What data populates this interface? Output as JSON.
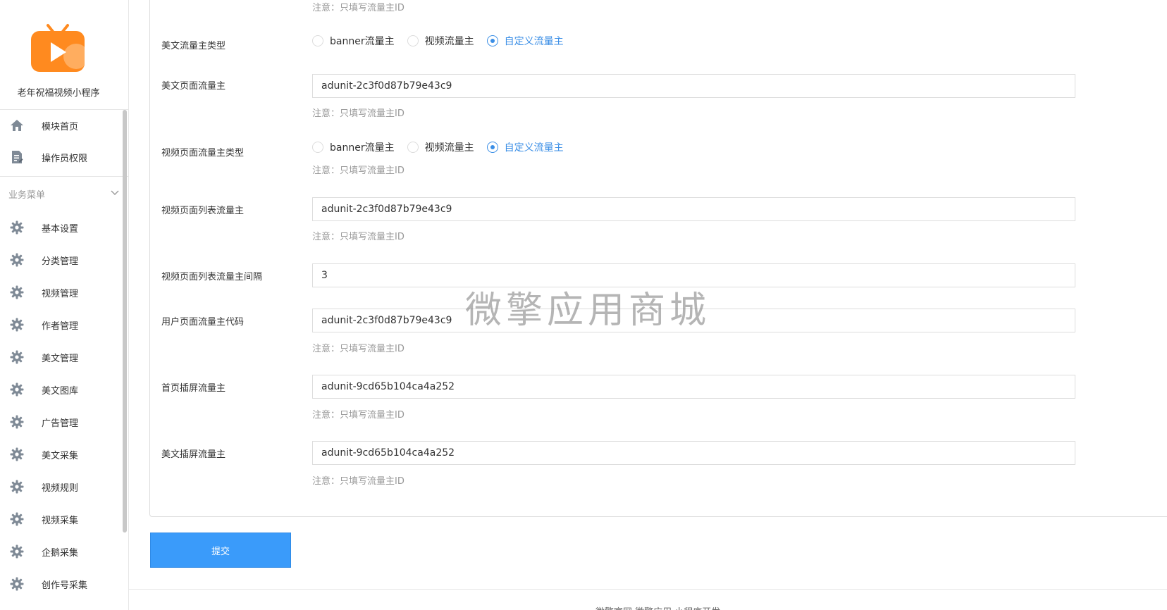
{
  "app": {
    "name": "老年祝福视频小程序"
  },
  "colors": {
    "accent": "#3a8ee6",
    "logo_orange": "#ff8a1f",
    "submit_bg": "#3a9bfa"
  },
  "sidebar": {
    "top_items": [
      {
        "label": "模块首页",
        "icon": "home-icon"
      },
      {
        "label": "操作员权限",
        "icon": "document-icon"
      }
    ],
    "group_title": "业务菜单",
    "group_items": [
      {
        "label": "基本设置",
        "icon": "gear-icon"
      },
      {
        "label": "分类管理",
        "icon": "gear-icon"
      },
      {
        "label": "视频管理",
        "icon": "gear-icon"
      },
      {
        "label": "作者管理",
        "icon": "gear-icon"
      },
      {
        "label": "美文管理",
        "icon": "gear-icon"
      },
      {
        "label": "美文图库",
        "icon": "gear-icon"
      },
      {
        "label": "广告管理",
        "icon": "gear-icon"
      },
      {
        "label": "美文采集",
        "icon": "gear-icon"
      },
      {
        "label": "视频规则",
        "icon": "gear-icon"
      },
      {
        "label": "视频采集",
        "icon": "gear-icon"
      },
      {
        "label": "企鹅采集",
        "icon": "gear-icon"
      },
      {
        "label": "创作号采集",
        "icon": "gear-icon"
      }
    ]
  },
  "form": {
    "note_text": "注意：只填写流量主ID",
    "radio_options": [
      "banner流量主",
      "视频流量主",
      "自定义流量主"
    ],
    "meiwen_type": {
      "label": "美文流量主类型",
      "selected": "自定义流量主"
    },
    "meiwen_page": {
      "label": "美文页面流量主",
      "value": "adunit-2c3f0d87b79e43c9"
    },
    "video_type": {
      "label": "视频页面流量主类型",
      "selected": "自定义流量主"
    },
    "video_list": {
      "label": "视频页面列表流量主",
      "value": "adunit-2c3f0d87b79e43c9"
    },
    "video_list_interval": {
      "label": "视频页面列表流量主间隔",
      "value": "3"
    },
    "user_page": {
      "label": "用户页面流量主代码",
      "value": "adunit-2c3f0d87b79e43c9"
    },
    "home_interstitial": {
      "label": "首页插屏流量主",
      "value": "adunit-9cd65b104ca4a252"
    },
    "meiwen_interstitial": {
      "label": "美文插屏流量主",
      "value": "adunit-9cd65b104ca4a252"
    },
    "submit_label": "提交"
  },
  "watermark": "微擎应用商城",
  "footer": {
    "text": "微擎官网     微擎应用     小程序开发"
  }
}
